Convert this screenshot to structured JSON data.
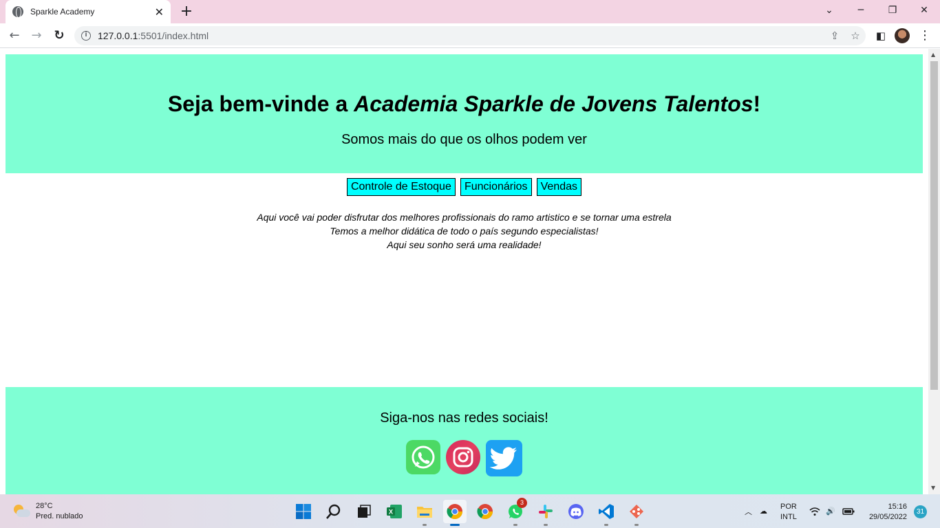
{
  "browser": {
    "tab_title": "Sparkle Academy",
    "url_host": "127.0.0.1",
    "url_path": ":5501/index.html"
  },
  "page": {
    "title_prefix": "Seja bem-vinde a ",
    "title_italic": "Academia Sparkle de Jovens Talentos",
    "title_suffix": "!",
    "subtitle": "Somos mais do que os olhos podem ver",
    "nav": [
      {
        "label": "Controle de Estoque"
      },
      {
        "label": "Funcionários"
      },
      {
        "label": "Vendas"
      }
    ],
    "intro_lines": [
      "Aqui você vai poder disfrutar dos melhores profissionais do ramo artistico e se tornar uma estrela",
      "Temos a melhor didática de todo o país segundo especialistas!",
      "Aqui seu sonho será uma realidade!"
    ],
    "footer_title": "Siga-nos nas redes sociais!",
    "social": [
      "whatsapp-icon",
      "instagram-icon",
      "twitter-icon"
    ]
  },
  "taskbar": {
    "weather_temp": "28°C",
    "weather_desc": "Pred. nublado",
    "whatsapp_badge": "3",
    "lang_1": "POR",
    "lang_2": "INTL",
    "time": "15:16",
    "date": "29/05/2022",
    "notifications": "31"
  },
  "colors": {
    "header_bg": "#7fffd4",
    "nav_btn_bg": "#00ffff",
    "titlebar_bg": "#f3d4e3"
  }
}
